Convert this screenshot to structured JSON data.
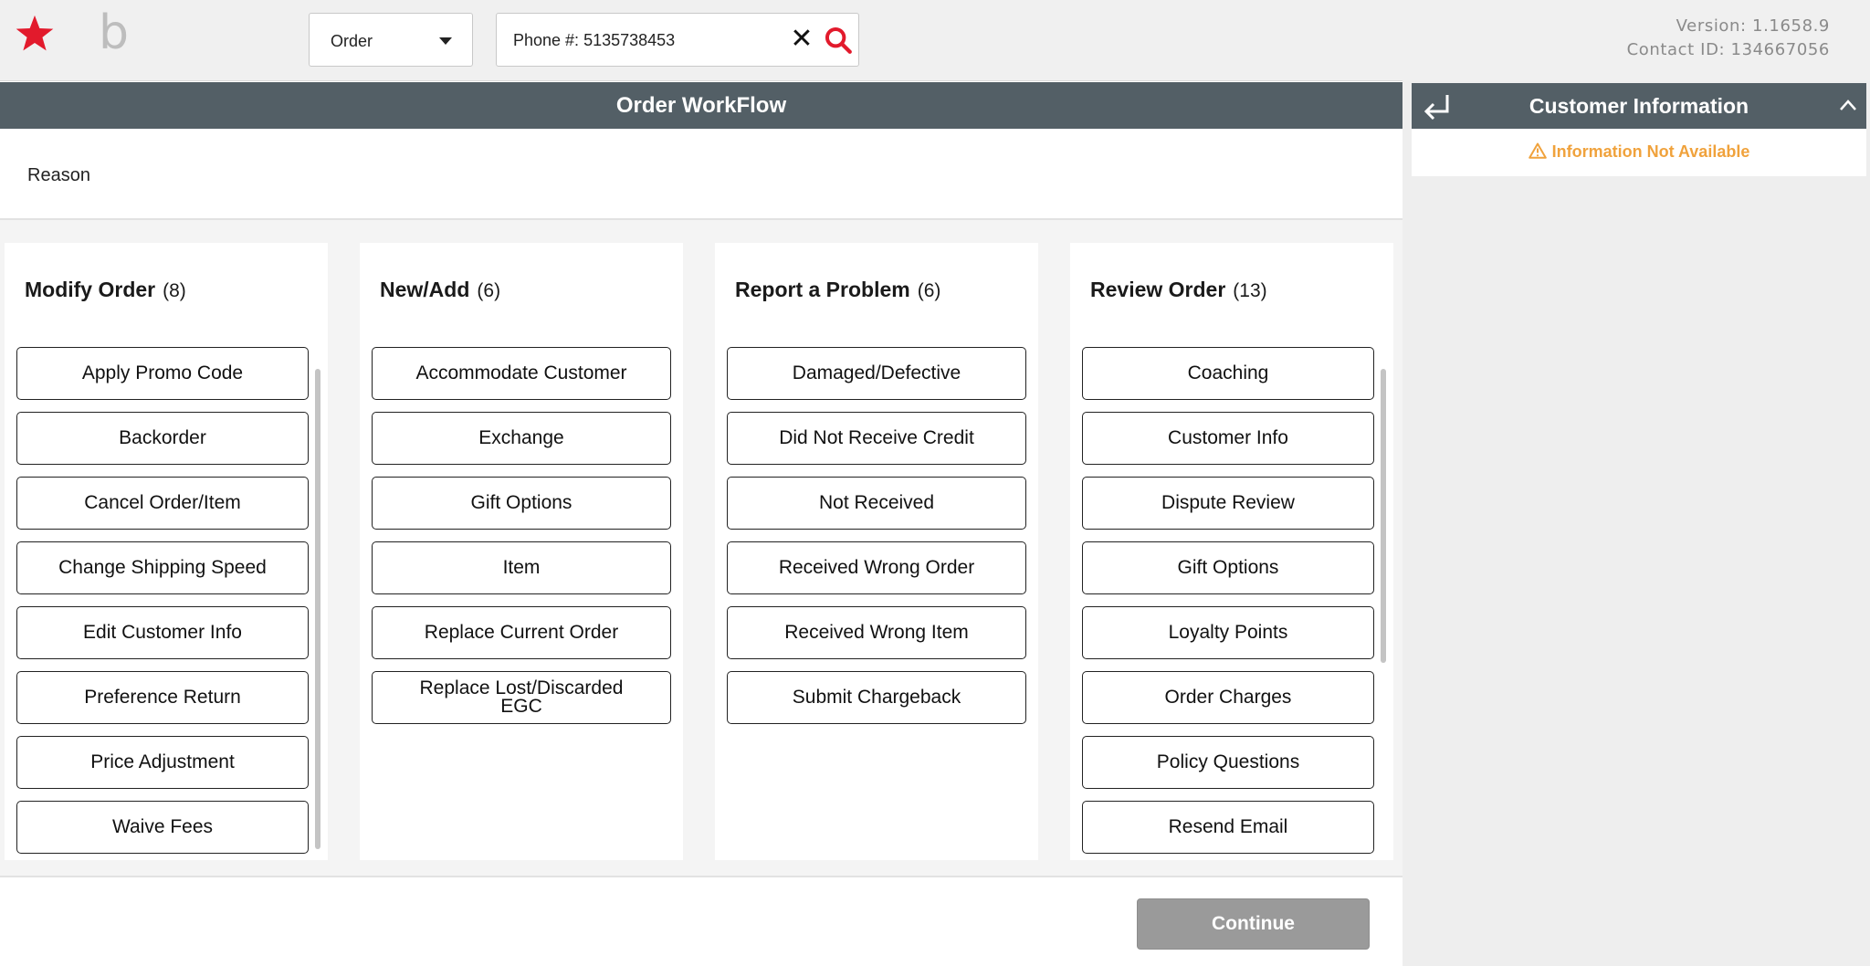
{
  "colors": {
    "brand_red": "#e21a2c",
    "header_bg": "#535f66",
    "warning": "#f0a23c",
    "continue_disabled": "#9a9a9a"
  },
  "topbar": {
    "logo_star_icon": "star-icon",
    "logo_b_text": "b",
    "type_dropdown": {
      "selected": "Order"
    },
    "search": {
      "value": "Phone #: 5135738453",
      "clear_icon": "close-icon",
      "search_icon": "search-icon"
    },
    "version": "Version: 1.1658.9",
    "contact_id": "Contact ID: 134667056"
  },
  "workflow": {
    "title": "Order WorkFlow",
    "reason_label": "Reason",
    "columns": [
      {
        "title": "Modify Order",
        "count": "(8)",
        "items": [
          "Apply Promo Code",
          "Backorder",
          "Cancel Order/Item",
          "Change Shipping Speed",
          "Edit Customer Info",
          "Preference Return",
          "Price Adjustment",
          "Waive Fees"
        ]
      },
      {
        "title": "New/Add",
        "count": "(6)",
        "items": [
          "Accommodate Customer",
          "Exchange",
          "Gift Options",
          "Item",
          "Replace Current Order",
          "Replace Lost/Discarded EGC"
        ]
      },
      {
        "title": "Report a Problem",
        "count": "(6)",
        "items": [
          "Damaged/Defective",
          "Did Not Receive Credit",
          "Not Received",
          "Received Wrong Order",
          "Received Wrong Item",
          "Submit Chargeback"
        ]
      },
      {
        "title": "Review Order",
        "count": "(13)",
        "items": [
          "Coaching",
          "Customer Info",
          "Dispute Review",
          "Gift Options",
          "Loyalty Points",
          "Order Charges",
          "Policy Questions",
          "Resend Email"
        ]
      }
    ],
    "continue_label": "Continue"
  },
  "customer_panel": {
    "title": "Customer Information",
    "message": "Information Not Available",
    "return_icon": "return-arrow-icon",
    "collapse_icon": "chevron-up-icon",
    "warning_icon": "warning-icon"
  }
}
